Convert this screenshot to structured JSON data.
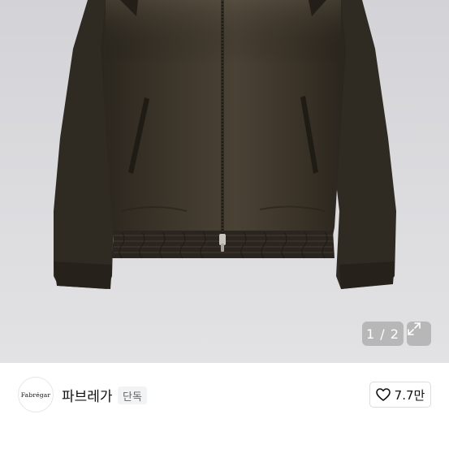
{
  "gallery": {
    "image_alt": "dark brown leather bomber jacket",
    "pager": "1 / 2",
    "expand_icon": "expand-arrows-icon"
  },
  "brand": {
    "logo_text": "Fabrégar",
    "name": "파브레가",
    "badge": "단독",
    "like_icon": "heart-outline-icon",
    "like_count": "7.7만"
  },
  "colors": {
    "jacket": "#3a3329",
    "background": "#d8d8db",
    "overlay": "rgba(150,150,150,0.55)"
  }
}
